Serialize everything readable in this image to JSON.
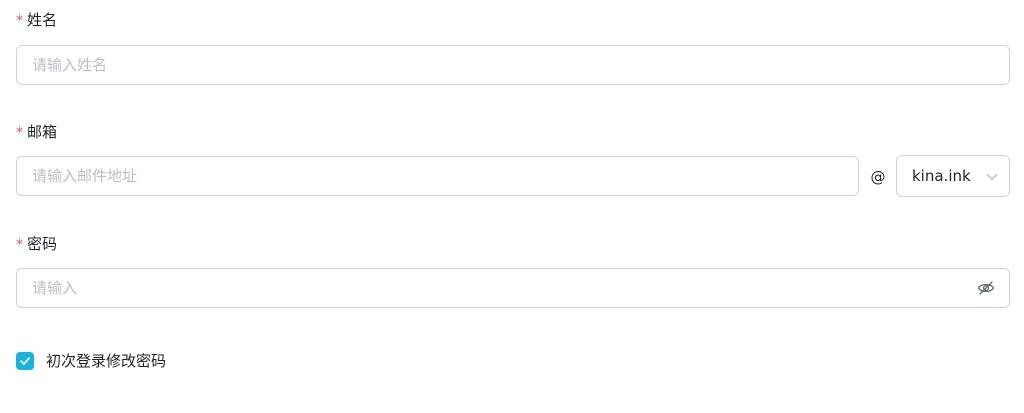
{
  "name_field": {
    "required_mark": "*",
    "label": "姓名",
    "placeholder": "请输入姓名",
    "value": ""
  },
  "email_field": {
    "required_mark": "*",
    "label": "邮箱",
    "placeholder": "请输入邮件地址",
    "value": "",
    "at_sign": "@",
    "domain_select": {
      "value": "kina.ink",
      "icon": "chevron-down-icon"
    }
  },
  "password_field": {
    "required_mark": "*",
    "label": "密码",
    "placeholder": "请输入",
    "value": "",
    "visibility_icon": "eye-off-icon"
  },
  "first_login_change_password": {
    "label": "初次登录修改密码",
    "checked": true
  },
  "colors": {
    "required": "#f54a45",
    "border": "#d0d3d6",
    "placeholder": "#bbbfc4",
    "checkbox_checked": "#12b5e0",
    "text": "#1f2329"
  }
}
